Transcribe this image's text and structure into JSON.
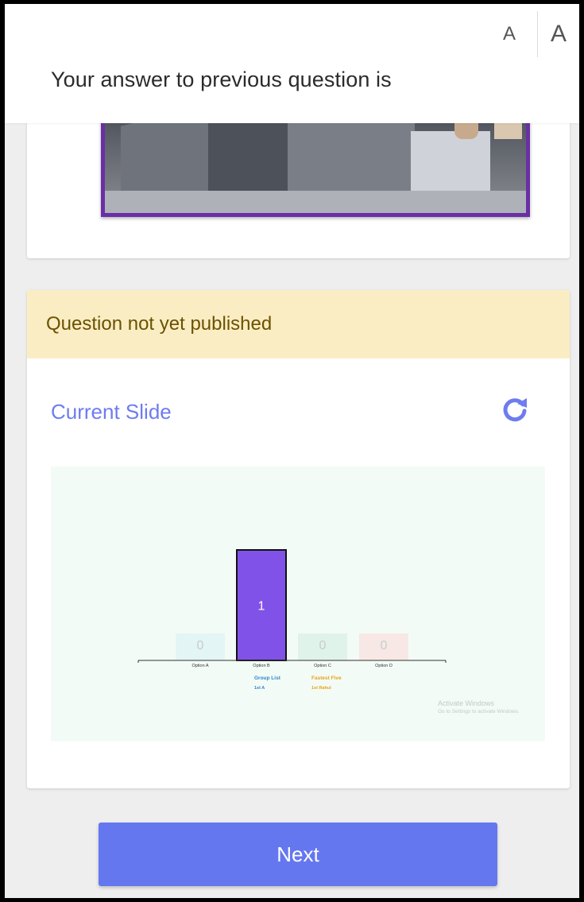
{
  "header": {
    "font_small": "A",
    "font_large": "A",
    "answer_label": "Your answer to previous question is"
  },
  "question_card": {
    "status": "Question not yet published",
    "slide_title": "Current Slide"
  },
  "chart_data": {
    "type": "bar",
    "categories": [
      "Option A",
      "Option B",
      "Option C",
      "Option D"
    ],
    "values": [
      0,
      1,
      0,
      0
    ],
    "colors": [
      "#e3f5f5",
      "#8152e8",
      "#e0f3ea",
      "#f7e8e6"
    ],
    "ylim": [
      0,
      1
    ],
    "group_list": {
      "title": "Group List",
      "rank": "1st",
      "value": "A"
    },
    "fastest_five": {
      "title": "Fastest Five",
      "rank": "1st",
      "value": "Rahul"
    }
  },
  "watermark": {
    "line1": "Activate Windows",
    "line2": "Go to Settings to activate Windows."
  },
  "footer": {
    "next_label": "Next"
  },
  "colors": {
    "accent": "#6577ef",
    "notice_bg": "#fbedc3",
    "notice_text": "#6b5200",
    "photo_border": "#6a2fa6"
  }
}
